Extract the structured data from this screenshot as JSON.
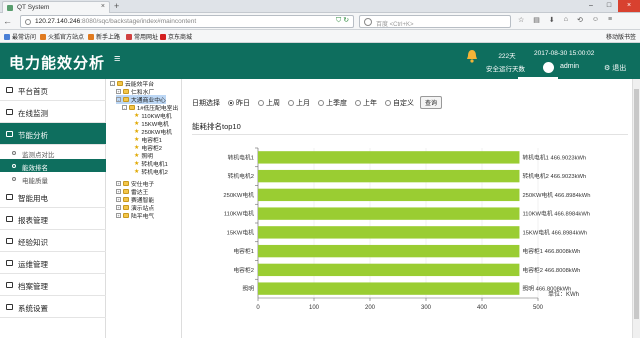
{
  "browser": {
    "tab_title": "QT System",
    "url_host": "120.27.140.246",
    "url_tail": ":8080/sqc/backstage/index#maincontent",
    "search_placeholder": "百度 <Ctrl+K>",
    "bookmarks": [
      "最常访问",
      "火狐官方站点",
      "新手上路",
      "常用网址",
      "京东商城"
    ],
    "mobile_bookmarks": "移动版书签"
  },
  "header": {
    "app_title": "电力能效分析",
    "menu_icon": "hamburger-icon",
    "safe_days": "222天",
    "safe_label": "安全运行天数",
    "datetime": "2017-08-30 15:00:02",
    "user": "admin",
    "logout": "退出",
    "bg_color": "#0e6e5e"
  },
  "sidebar": {
    "items": [
      {
        "label": "平台首页",
        "icon": "home-icon"
      },
      {
        "label": "在线监测",
        "icon": "chart-icon"
      },
      {
        "label": "节能分析",
        "icon": "leaf-icon",
        "active": true
      },
      {
        "label": "智能用电",
        "icon": "plug-icon"
      },
      {
        "label": "报表管理",
        "icon": "report-icon"
      },
      {
        "label": "经验知识",
        "icon": "knowledge-icon"
      },
      {
        "label": "运维管理",
        "icon": "wrench-icon"
      },
      {
        "label": "档案管理",
        "icon": "archive-icon"
      },
      {
        "label": "系统设置",
        "icon": "settings-icon"
      }
    ],
    "subitems": [
      {
        "label": "监测点对比"
      },
      {
        "label": "能效排名",
        "selected": true
      },
      {
        "label": "电能质量"
      }
    ]
  },
  "tree": [
    {
      "label": "云能效平台",
      "type": "folder",
      "depth": 0
    },
    {
      "label": "仁和水厂",
      "type": "folder",
      "depth": 1
    },
    {
      "label": "大通商业中心",
      "type": "folder",
      "depth": 1,
      "highlight": true
    },
    {
      "label": "1#低压配电室出",
      "type": "folder",
      "depth": 2
    },
    {
      "label": "110KW电机",
      "type": "star",
      "depth": 3
    },
    {
      "label": "15KW电机",
      "type": "star",
      "depth": 3
    },
    {
      "label": "250KW电机",
      "type": "star",
      "depth": 3
    },
    {
      "label": "电容柜1",
      "type": "star",
      "depth": 3
    },
    {
      "label": "电容柜2",
      "type": "star",
      "depth": 3
    },
    {
      "label": "照明",
      "type": "star",
      "depth": 3
    },
    {
      "label": "转机电机1",
      "type": "star",
      "depth": 3
    },
    {
      "label": "转机电机2",
      "type": "star",
      "depth": 3
    },
    {
      "label": "安仕电子",
      "type": "folder",
      "depth": 1
    },
    {
      "label": "雷达王",
      "type": "folder",
      "depth": 1
    },
    {
      "label": "赛通智能",
      "type": "folder",
      "depth": 1
    },
    {
      "label": "演示站点",
      "type": "folder",
      "depth": 1
    },
    {
      "label": "陆平电气",
      "type": "folder",
      "depth": 1
    }
  ],
  "filter": {
    "label": "日期选择",
    "options": [
      "昨日",
      "上周",
      "上月",
      "上季度",
      "上年",
      "自定义"
    ],
    "selected": "昨日",
    "query_button": "查询"
  },
  "panel": {
    "title": "能耗排名top10"
  },
  "chart_data": {
    "type": "bar",
    "orientation": "horizontal",
    "categories": [
      "转机电机1",
      "转机电机2",
      "250KW电机",
      "110KW电机",
      "15KW电机",
      "电容柜1",
      "电容柜2",
      "照明"
    ],
    "values": [
      466.9023,
      466.9023,
      466.8984,
      466.8984,
      466.8984,
      466.8008,
      466.8008,
      466.8008
    ],
    "data_labels": [
      "转机电机1 466.9023kWh",
      "转机电机2 466.9023kWh",
      "250KW电机 466.8984kWh",
      "110KW电机 466.8984kWh",
      "15KW电机 466.8984kWh",
      "电容柜1 466.8008kWh",
      "电容柜2 466.8008kWh",
      "照明 466.8008kWh"
    ],
    "xlim": [
      0,
      500
    ],
    "xticks": [
      "0",
      "100",
      "200",
      "300",
      "400",
      "500"
    ],
    "unit": "单位：KWh",
    "bar_color": "#9acd32",
    "grid": true
  }
}
